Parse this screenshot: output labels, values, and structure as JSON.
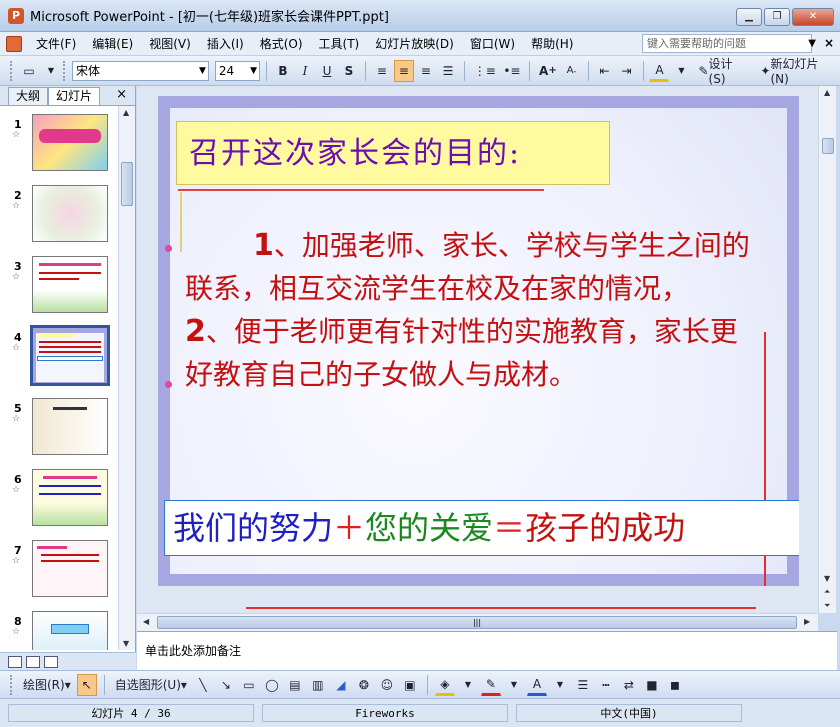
{
  "window": {
    "title": "Microsoft PowerPoint - [初一(七年级)班家长会课件PPT.ppt]",
    "app_icon": "P"
  },
  "menu": {
    "items": [
      "文件(F)",
      "编辑(E)",
      "视图(V)",
      "插入(I)",
      "格式(O)",
      "工具(T)",
      "幻灯片放映(D)",
      "窗口(W)",
      "帮助(H)"
    ],
    "help_placeholder": "键入需要帮助的问题"
  },
  "toolbar": {
    "font_name": "宋体",
    "font_size": "24",
    "bold": "B",
    "italic": "I",
    "underline": "U",
    "shadow": "S",
    "font_increase": "A",
    "font_decrease": "A",
    "font_color": "A",
    "design": "设计(S)",
    "new_slide": "新幻灯片(N)"
  },
  "panel": {
    "tabs": [
      "大纲",
      "幻灯片"
    ],
    "close": "×"
  },
  "thumbnails": [
    {
      "num": "1",
      "star": "☆"
    },
    {
      "num": "2",
      "star": "☆"
    },
    {
      "num": "3",
      "star": "☆"
    },
    {
      "num": "4",
      "star": "☆"
    },
    {
      "num": "5",
      "star": "☆"
    },
    {
      "num": "6",
      "star": "☆"
    },
    {
      "num": "7",
      "star": "☆"
    },
    {
      "num": "8",
      "star": "☆"
    }
  ],
  "slide": {
    "title": "召开这次家长会的目的:",
    "point1_num": "1",
    "point1": "、加强老师、家长、学校与学生之间的联系，相互交流学生在校及在家的情况，",
    "point2_num": "2",
    "point2": "、便于老师更有针对性的实施教育，家长更好教育自己的子女做人与成材。",
    "slogan_parts": [
      "我们的努力",
      "＋",
      "您的关爱",
      "＝",
      "孩子的成功"
    ]
  },
  "notes": {
    "placeholder": "单击此处添加备注"
  },
  "drawbar": {
    "draw": "绘图(R)",
    "autoshapes": "自选图形(U)"
  },
  "status": {
    "slide": "幻灯片 4 / 36",
    "theme": "Fireworks",
    "language": "中文(中国)"
  },
  "colors": {
    "title_bg": "#fff9a0",
    "title_text": "#6b0fb0",
    "body_text": "#c41010",
    "frame": "#a6a7e0"
  }
}
